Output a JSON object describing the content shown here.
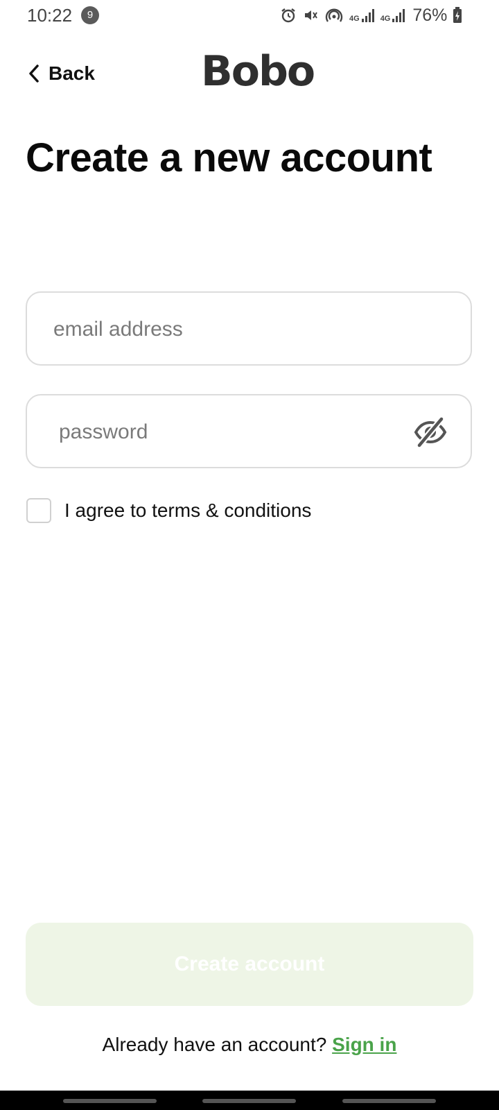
{
  "status_bar": {
    "time": "10:22",
    "notification_count": "9",
    "battery": "76%",
    "network_1": "4G",
    "network_2": "4G"
  },
  "header": {
    "back_label": "Back",
    "logo_text": "Bobo"
  },
  "page": {
    "title": "Create a new account"
  },
  "form": {
    "email_placeholder": "email address",
    "email_value": "",
    "password_placeholder": "password",
    "password_value": "",
    "terms_label": "I agree to terms & conditions",
    "terms_checked": false
  },
  "actions": {
    "create_account_label": "Create account",
    "already_have_account": "Already have an account?",
    "sign_in_label": "Sign in"
  },
  "colors": {
    "accent": "#4aa34a",
    "button_disabled_bg": "#eef5e6",
    "logo": "#2f2f2f"
  }
}
